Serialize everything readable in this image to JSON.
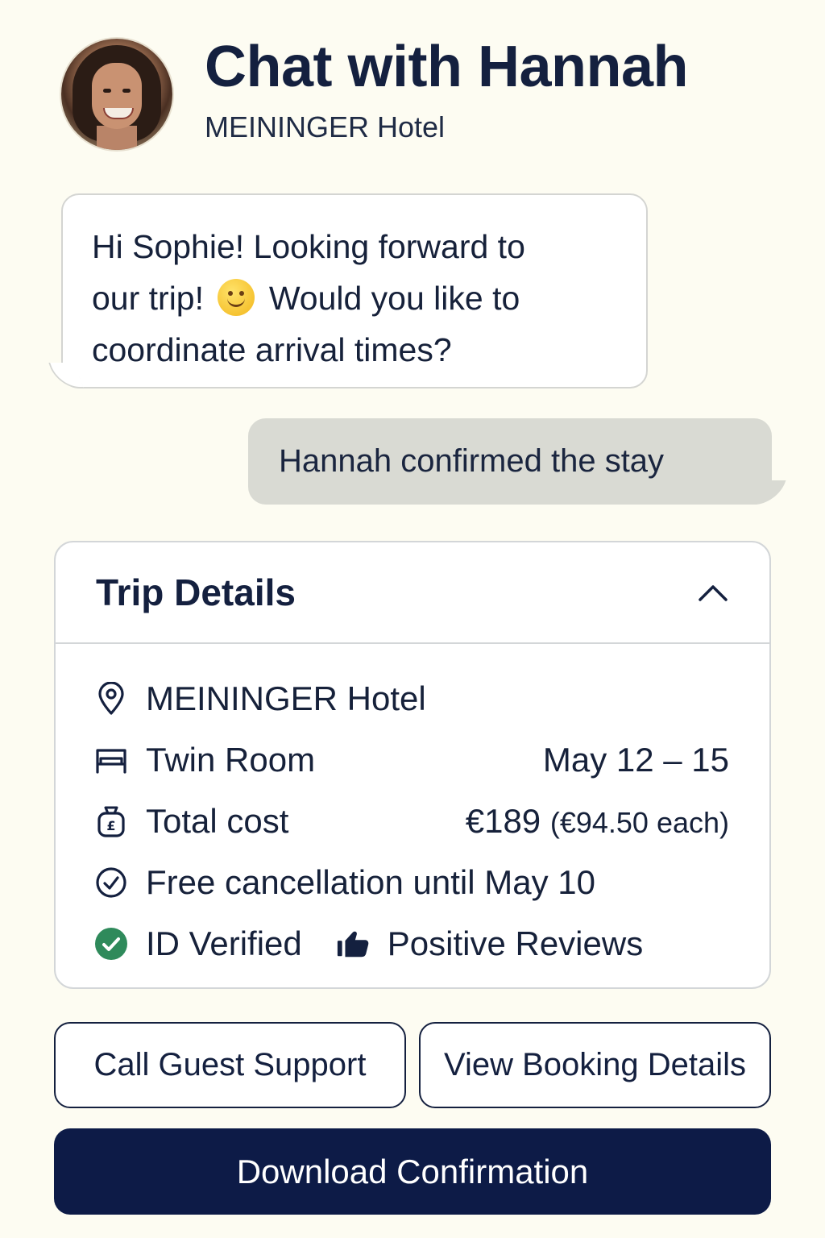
{
  "header": {
    "title": "Chat with Hannah",
    "subtitle": "MEININGER Hotel"
  },
  "messages": {
    "incoming_line1": "Hi Sophie! Looking forward to",
    "incoming_line2a": "our trip!",
    "incoming_line2b": "Would you like to",
    "incoming_line3": "coordinate arrival times?",
    "incoming_emoji": "slightly-smiling-face",
    "outgoing": "Hannah confirmed the stay"
  },
  "trip": {
    "title": "Trip Details",
    "hotel": "MEININGER Hotel",
    "room": "Twin Room",
    "dates": "May 12 – 15",
    "cost_label": "Total cost",
    "cost_value": "€189",
    "cost_each": "(€94.50 each)",
    "cancellation": "Free cancellation until May 10",
    "id_verified": "ID Verified",
    "reviews": "Positive Reviews"
  },
  "actions": {
    "call_support": "Call Guest Support",
    "view_booking": "View Booking Details",
    "download": "Download Confirmation"
  },
  "colors": {
    "background": "#fdfcf2",
    "navy": "#14203f",
    "primary_button": "#0d1b47",
    "outgoing_bubble": "#d9dad3",
    "verified_green": "#2f8a5b"
  }
}
